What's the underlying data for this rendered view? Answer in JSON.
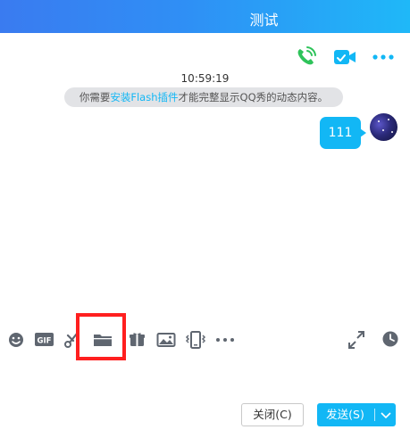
{
  "window": {
    "title": "测试"
  },
  "top_actions": {
    "voice_icon": "phone-icon",
    "video_icon": "video-camera-icon",
    "more_icon": "more-dots-icon"
  },
  "chat": {
    "timestamp": "10:59:19",
    "notice": {
      "prefix": "你需要",
      "link": "安装Flash插件",
      "suffix": "才能完整显示QQ秀的动态内容。"
    },
    "messages": [
      {
        "from": "self",
        "text": "111"
      }
    ]
  },
  "toolbar": {
    "left_icons": [
      "emoji-icon",
      "gif-icon",
      "scissors-icon",
      "folder-icon",
      "gift-icon",
      "image-icon",
      "shake-icon",
      "more-dots-icon"
    ],
    "right_icons": [
      "expand-icon",
      "clock-icon"
    ],
    "highlighted": "folder-icon"
  },
  "buttons": {
    "close_label": "关闭(C)",
    "send_label": "发送(S)"
  },
  "colors": {
    "accent": "#12b7f5",
    "highlight": "#ff1f1f",
    "call_green": "#2ec35a"
  }
}
